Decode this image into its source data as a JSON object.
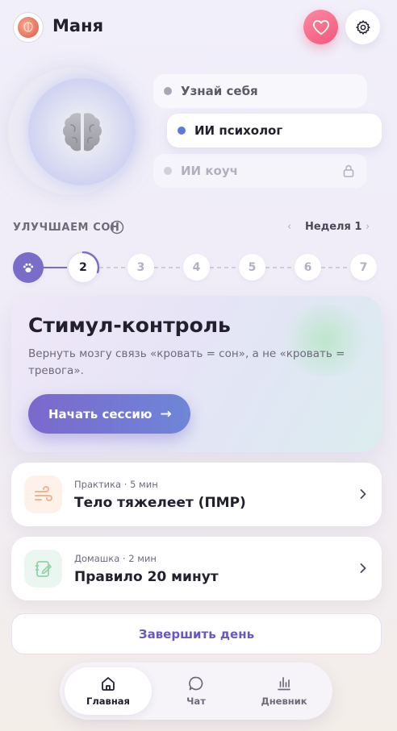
{
  "header": {
    "username": "Маня",
    "avatar_icon": "brain-icon",
    "favorite_icon": "heart-icon",
    "settings_icon": "gear-icon"
  },
  "modes": [
    {
      "label": "Узнай себя",
      "state": "inactive"
    },
    {
      "label": "ИИ психолог",
      "state": "selected"
    },
    {
      "label": "ИИ коуч",
      "state": "locked"
    }
  ],
  "program": {
    "title": "УЛУЧШАЕМ СОН",
    "week_label": "Неделя 1",
    "steps": [
      "2",
      "3",
      "4",
      "5",
      "6",
      "7"
    ],
    "completed_icon": "paw-icon",
    "current_progress": 0.3
  },
  "hero": {
    "title": "Стимул-контроль",
    "description": "Вернуть мозгу связь «кровать = сон», а не «кровать = тревога».",
    "button_label": "Начать сессию",
    "button_arrow": "→"
  },
  "tasks": [
    {
      "meta": "Практика · 5 мин",
      "title": "Тело тяжелеет (ПМР)",
      "icon": "wind-icon"
    },
    {
      "meta": "Домашка · 2 мин",
      "title": "Правило 20 минут",
      "icon": "notebook-icon"
    }
  ],
  "finish_label": "Завершить день",
  "nav": [
    {
      "label": "Главная",
      "icon": "home-icon",
      "active": true
    },
    {
      "label": "Чат",
      "icon": "chat-icon",
      "active": false
    },
    {
      "label": "Дневник",
      "icon": "chart-icon",
      "active": false
    }
  ],
  "colors": {
    "accent": "#7a6cc9",
    "heart": "#f0577a",
    "selected_dot": "#5b7ae0"
  }
}
